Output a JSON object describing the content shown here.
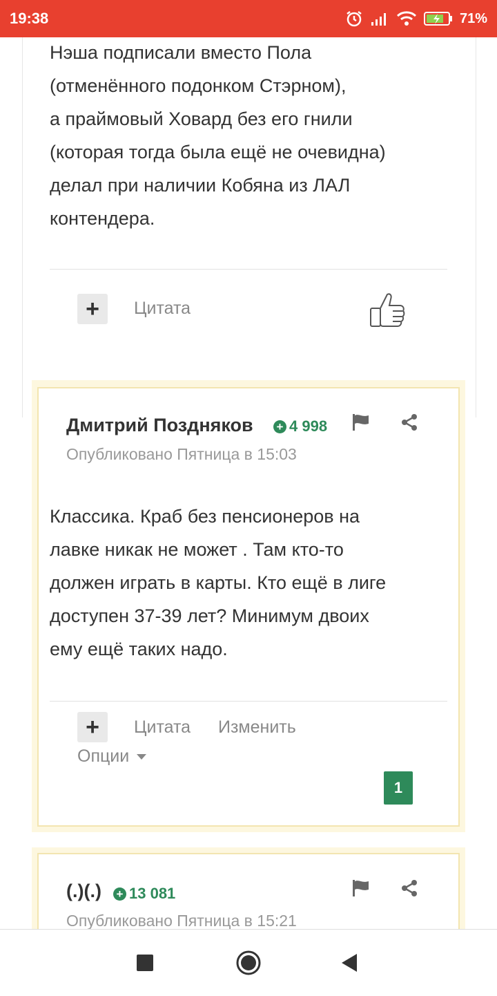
{
  "status_bar": {
    "time": "19:38",
    "battery": "71%"
  },
  "prev_post": {
    "lines": [
      "Нэша подписали вместо Пола",
      "(отменённого подонком Стэрном),",
      "а праймовый Ховард без его гнили",
      "(которая тогда была ещё не очевидна)",
      "делал при наличии Кобяна из ЛАЛ",
      "контендера."
    ],
    "quote_label": "Цитата"
  },
  "post1": {
    "author": "Дмитрий Поздняков",
    "reputation": "4 998",
    "published": "Опубликовано Пятница в 15:03",
    "lines": [
      "Классика. Краб без пенсионеров на",
      "лавке никак не может . Там кто-то",
      "должен играть в карты. Кто ещё в лиге",
      "доступен 37-39 лет? Минимум двоих",
      "ему ещё таких надо."
    ],
    "quote_label": "Цитата",
    "edit_label": "Изменить",
    "options_label": "Опции",
    "likes": "1"
  },
  "post2": {
    "author": "(.)(.)",
    "reputation": "13 081",
    "published": "Опубликовано Пятница в 15:21"
  },
  "colors": {
    "status_bar": "#e8402f",
    "reputation": "#2e8a5a",
    "highlight": "#fdf7df"
  }
}
